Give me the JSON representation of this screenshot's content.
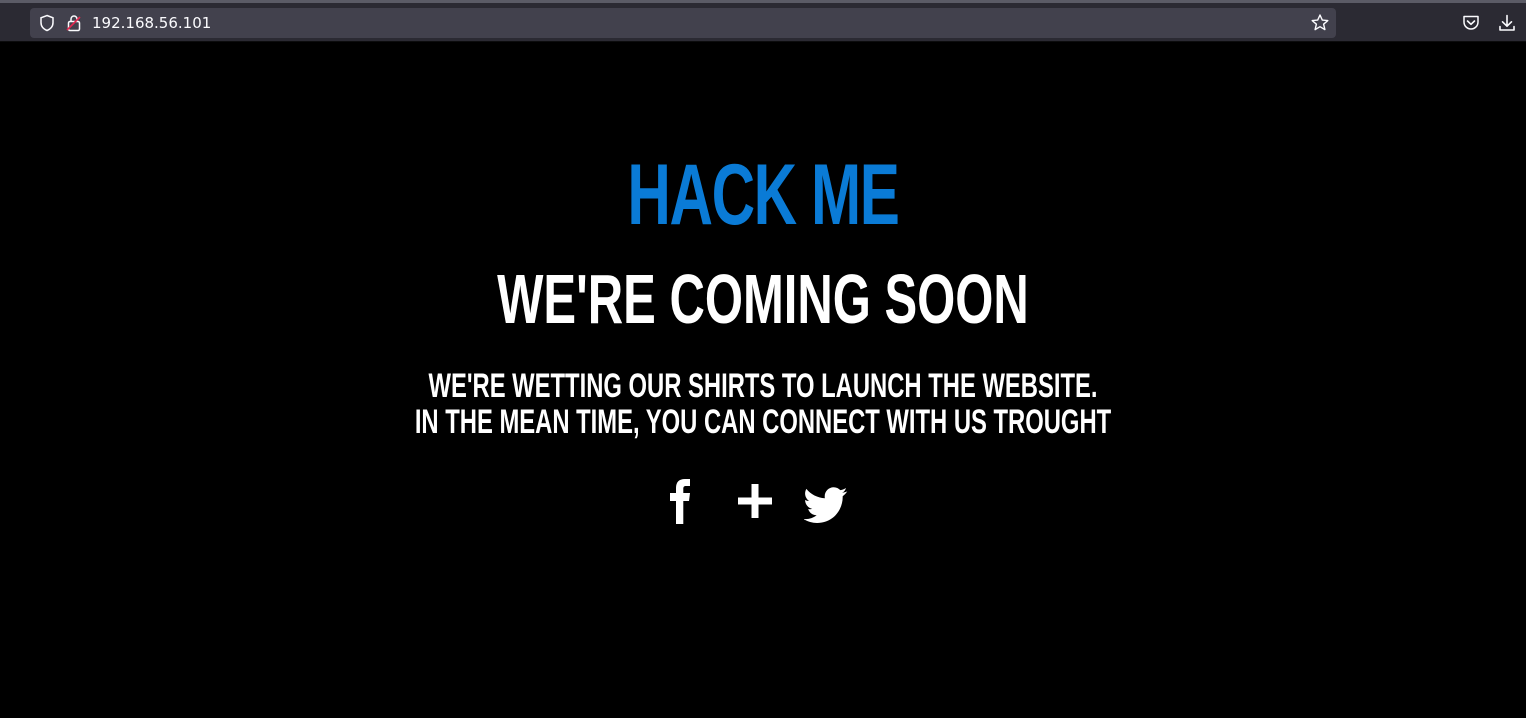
{
  "browser": {
    "url": "192.168.56.101",
    "icons": [
      "shield-icon",
      "lock-insecure-icon",
      "bookmark-star-icon",
      "pocket-icon",
      "download-icon"
    ]
  },
  "page": {
    "brand": "HACK ME",
    "headline": "WE'RE COMING SOON",
    "message_line1": "WE'RE WETTING OUR SHIRTS TO LAUNCH THE WEBSITE.",
    "message_line2": "IN THE MEAN TIME, YOU CAN CONNECT WITH US TROUGHT",
    "social_links": [
      "facebook-icon",
      "google-plus-icon",
      "twitter-icon"
    ],
    "colors": {
      "background": "#000000",
      "brand": "#0a7bd6",
      "text": "#ffffff"
    }
  }
}
